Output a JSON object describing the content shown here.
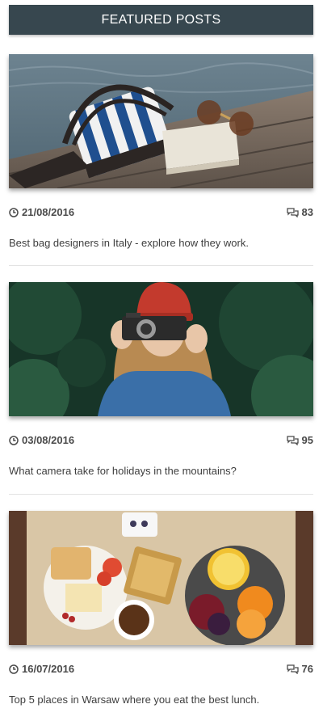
{
  "header": {
    "title": "FEATURED POSTS"
  },
  "posts": [
    {
      "date": "21/08/2016",
      "comments": "83",
      "title": "Best bag designers in Italy - explore how they work."
    },
    {
      "date": "03/08/2016",
      "comments": "95",
      "title": "What camera take for holidays in the mountains?"
    },
    {
      "date": "16/07/2016",
      "comments": "76",
      "title": "Top 5 places in Warsaw where you eat the best lunch."
    }
  ],
  "colors": {
    "header_bg": "#37474f",
    "header_text": "#ffffff",
    "text": "#4a4a4a"
  },
  "icons": {
    "date": "clock-icon",
    "comments": "comments-icon"
  }
}
